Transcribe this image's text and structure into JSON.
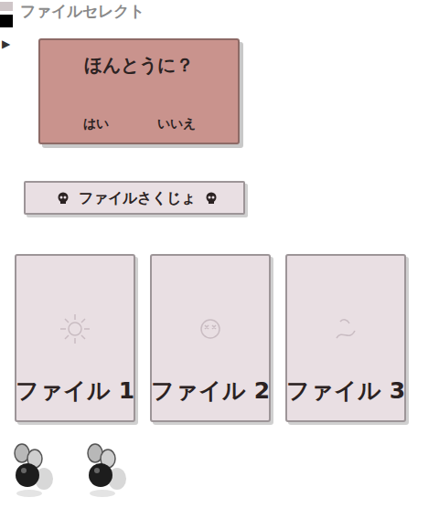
{
  "header": {
    "title": "ファイルセレクト"
  },
  "cursor": "▶",
  "dialog": {
    "question": "ほんとうに？",
    "buttons": [
      "はい",
      "いいえ"
    ]
  },
  "delete_button": {
    "label": "ファイルさくじょ"
  },
  "files": [
    {
      "label": "ファイル 1"
    },
    {
      "label": "ファイル 2"
    },
    {
      "label": "ファイル 3"
    }
  ]
}
